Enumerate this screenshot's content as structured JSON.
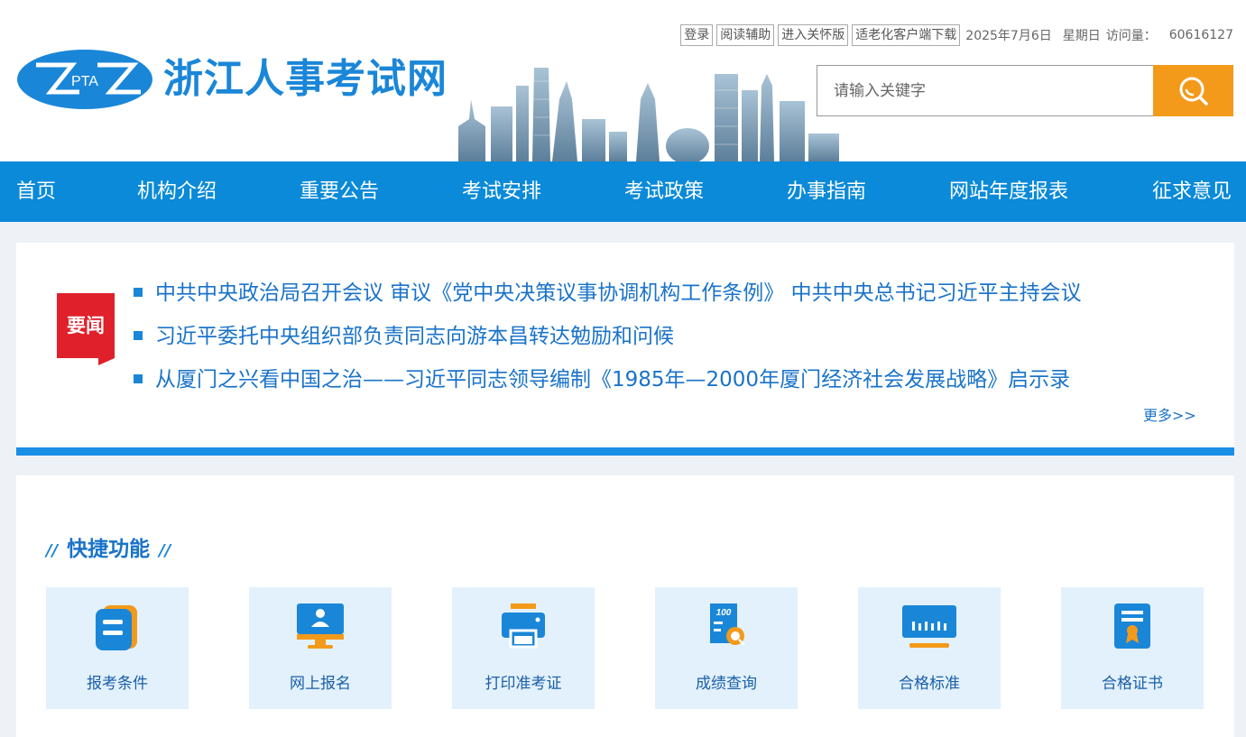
{
  "header": {
    "logo_text": "PTA",
    "site_title": "浙江人事考试网",
    "top_links": [
      "登录",
      "阅读辅助",
      "进入关怀版",
      "适老化客户端下载"
    ],
    "date": "2025年7月6日",
    "weekday": "星期日",
    "visit_label": "访问量：",
    "visit_count": "60616127",
    "search_placeholder": "请输入关键字"
  },
  "nav": {
    "items": [
      "首页",
      "机构介绍",
      "重要公告",
      "考试安排",
      "考试政策",
      "办事指南",
      "网站年度报表",
      "征求意见"
    ]
  },
  "news": {
    "badge": "要闻",
    "items": [
      "中共中央政治局召开会议 审议《党中央决策议事协调机构工作条例》 中共中央总书记习近平主持会议",
      "习近平委托中央组织部负责同志向游本昌转达勉励和问候",
      "从厦门之兴看中国之治——习近平同志领导编制《1985年—2000年厦门经济社会发展战略》启示录"
    ],
    "more": "更多>>"
  },
  "quick": {
    "title": "快捷功能",
    "title_deco": "//",
    "items": [
      {
        "label": "报考条件",
        "icon": "conditions-icon"
      },
      {
        "label": "网上报名",
        "icon": "online-register-icon"
      },
      {
        "label": "打印准考证",
        "icon": "printer-icon"
      },
      {
        "label": "成绩查询",
        "icon": "score-query-icon"
      },
      {
        "label": "合格标准",
        "icon": "ruler-icon"
      },
      {
        "label": "合格证书",
        "icon": "certificate-icon"
      }
    ]
  },
  "colors": {
    "brand_blue": "#0a8ad8",
    "search_orange": "#f39a1b",
    "card_bg": "#e3f1fc",
    "badge_red": "#e0202a"
  }
}
